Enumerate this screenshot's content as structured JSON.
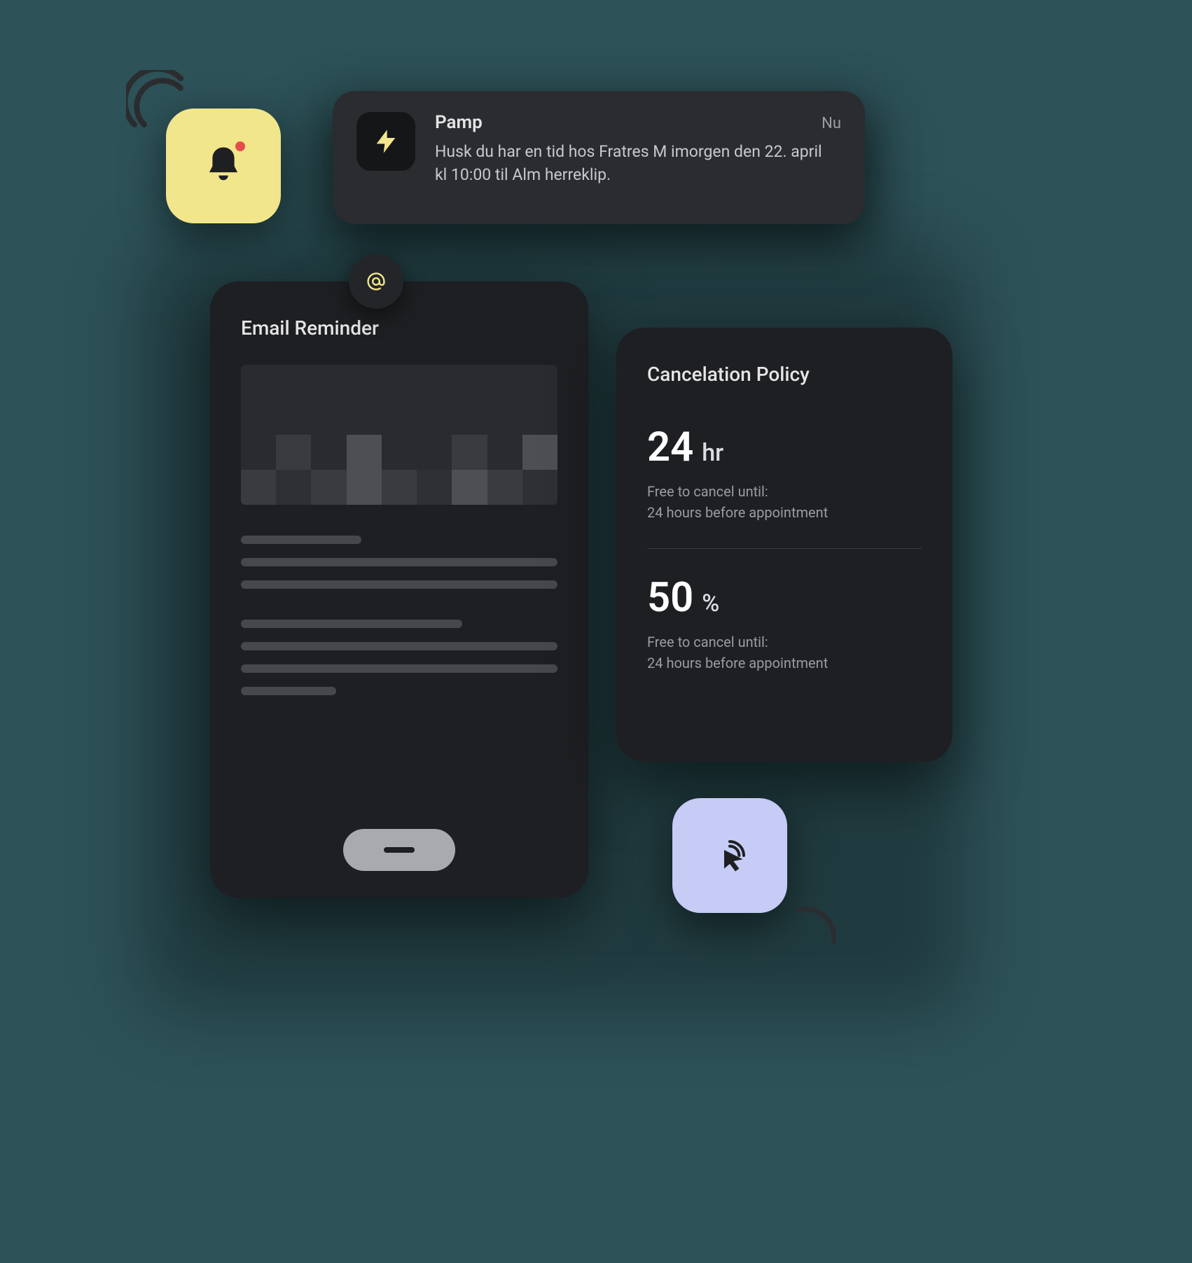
{
  "notification": {
    "app_name": "Pamp",
    "time_label": "Nu",
    "message": "Husk du har en tid hos Fratres M imorgen den 22. april kl 10:00 til Alm herreklip."
  },
  "email_reminder": {
    "title": "Email Reminder"
  },
  "cancellation": {
    "title": "Cancelation Policy",
    "metric1": {
      "value": "24",
      "unit": "hr",
      "sub1": "Free to cancel until:",
      "sub2": "24 hours before appointment"
    },
    "metric2": {
      "value": "50",
      "unit": "%",
      "sub1": "Free to cancel until:",
      "sub2": "24 hours before appointment"
    }
  },
  "colors": {
    "yellow": "#f2e68c",
    "lavender": "#c6ccf5",
    "card": "#1e1f22"
  }
}
